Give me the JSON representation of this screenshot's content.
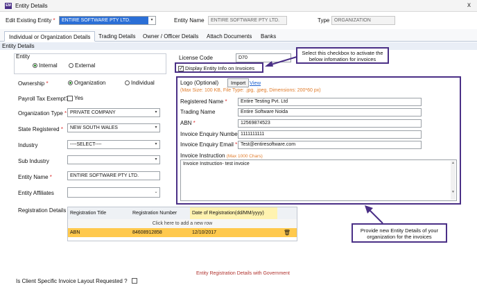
{
  "window": {
    "title": "Entity Details",
    "close": "x"
  },
  "top": {
    "edit_label": "Edit Existing Entity",
    "edit_value": "ENTIRE SOFTWARE PTY LTD.",
    "entity_name_label": "Entity Name",
    "entity_name_value": "ENTIRE SOFTWARE PTY LTD.",
    "type_label": "Type",
    "type_value": "ORGANIZATION"
  },
  "tabs": [
    "Individual or Organization Details",
    "Trading Details",
    "Owner / Officer Details",
    "Attach Documents",
    "Banks"
  ],
  "section_title": "Entity Details",
  "entity_group": {
    "title": "Entity",
    "internal": "Internal",
    "external": "External"
  },
  "left_form": {
    "ownership_label": "Ownership",
    "ownership_org": "Organization",
    "ownership_ind": "Individual",
    "payroll_label": "Payroll Tax Exempt?",
    "payroll_yes": "Yes",
    "org_type_label": "Organization Type",
    "org_type_value": "PRIVATE COMPANY",
    "state_label": "State Registered",
    "state_value": "NEW SOUTH WALES",
    "industry_label": "Industry",
    "industry_value": "----SELECT----",
    "sub_industry_label": "Sub Industry",
    "sub_industry_value": "",
    "entity_name_label": "Entity Name",
    "entity_name_value": "ENTIRE SOFTWARE PTY LTD.",
    "affiliates_label": "Entity Affiliates",
    "reg_details_label": "Registration Details"
  },
  "reg_table": {
    "headers": [
      "Registration Title",
      "Registration Number",
      "Date of Registration(dd/MM/yyyy)"
    ],
    "add_row": "Click here to add a new row",
    "rows": [
      {
        "title": "ABN",
        "number": "84608912858",
        "date": "12/10/2017"
      }
    ],
    "caption": "Entity Registration Details with Government"
  },
  "license": {
    "label": "License Code",
    "value": "D70"
  },
  "display_info": "Display Entity Info on Invoices",
  "callout_top": "Select this checkbox to activate the below infomation for invoices",
  "callout_bottom": "Provide new Entity Details of your organization for the invoices",
  "invoice": {
    "logo_label": "Logo (Optional)",
    "import": "Import",
    "view": "View",
    "logo_hint": "(Max Size: 100 KB, File Type: .jpg, .jpeg, Dimensions: 200*60 px)",
    "reg_name_label": "Registered Name",
    "reg_name_value": "Entire Testing Pvt. Ltd",
    "trading_label": "Trading Name",
    "trading_value": "Entire Software Noida",
    "abn_label": "ABN",
    "abn_value": "12569874523",
    "enquiry_num_label": "Invoice Enquiry Number",
    "enquiry_num_value": "1111111111",
    "enquiry_email_label": "Invoice Enquiry Email",
    "enquiry_email_value": "Test@entiresoftware.com",
    "instruction_label": "Invoice Instruction",
    "instruction_hint": "(Max 1000 Chars)",
    "instruction_value": "Invoice Instruction- test invoice"
  },
  "bottom_question": "Is Client Specific Invoice Layout Requested ?",
  "colors": {
    "accent": "#4a2f86",
    "selection": "#2b6fd6",
    "highlight_row": "#ffc94d",
    "date_header": "#fff3b0"
  }
}
